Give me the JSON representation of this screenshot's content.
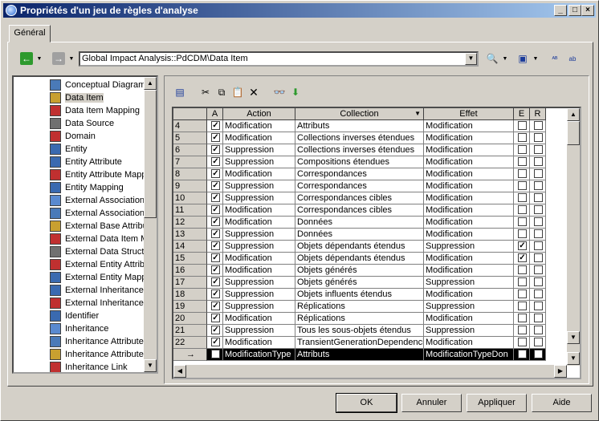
{
  "window": {
    "title": "Propriétés d'un jeu de règles d'analyse",
    "controls": [
      "_",
      "□",
      "×"
    ]
  },
  "tab": "Général",
  "path": "Global Impact Analysis::PdCDM\\Data Item",
  "tree": [
    "Conceptual Diagram",
    "Data Item",
    "Data Item Mapping",
    "Data Source",
    "Domain",
    "Entity",
    "Entity Attribute",
    "Entity Attribute Mappin",
    "Entity Mapping",
    "External Association A",
    "External Association M",
    "External Base Attribut",
    "External Data Item Ma",
    "External Data Structu",
    "External Entity Attribut",
    "External Entity Mappin",
    "External Inheritance A",
    "External Inheritance M",
    "Identifier",
    "Inheritance",
    "Inheritance Attribute",
    "Inheritance Attribute M",
    "Inheritance Link"
  ],
  "tree_selected": 1,
  "grid": {
    "headers": [
      "A",
      "Action",
      "Collection",
      "Effet",
      "E",
      "R"
    ],
    "rows": [
      [
        "4",
        "Modification",
        "Attributs",
        "Modification",
        false,
        false
      ],
      [
        "5",
        "Modification",
        "Collections inverses étendues",
        "Modification",
        false,
        false
      ],
      [
        "6",
        "Suppression",
        "Collections inverses étendues",
        "Modification",
        false,
        false
      ],
      [
        "7",
        "Suppression",
        "Compositions étendues",
        "Modification",
        false,
        false
      ],
      [
        "8",
        "Modification",
        "Correspondances",
        "Modification",
        false,
        false
      ],
      [
        "9",
        "Suppression",
        "Correspondances",
        "Modification",
        false,
        false
      ],
      [
        "10",
        "Suppression",
        "Correspondances cibles",
        "Modification",
        false,
        false
      ],
      [
        "11",
        "Modification",
        "Correspondances cibles",
        "Modification",
        false,
        false
      ],
      [
        "12",
        "Modification",
        "Données",
        "Modification",
        false,
        false
      ],
      [
        "13",
        "Suppression",
        "Données",
        "Modification",
        false,
        false
      ],
      [
        "14",
        "Suppression",
        "Objets dépendants étendus",
        "Suppression",
        true,
        false
      ],
      [
        "15",
        "Modification",
        "Objets dépendants étendus",
        "Modification",
        true,
        false
      ],
      [
        "16",
        "Modification",
        "Objets générés",
        "Modification",
        false,
        false
      ],
      [
        "17",
        "Suppression",
        "Objets générés",
        "Suppression",
        false,
        false
      ],
      [
        "18",
        "Suppression",
        "Objets influents étendus",
        "Modification",
        false,
        false
      ],
      [
        "19",
        "Suppression",
        "Réplications",
        "Suppression",
        false,
        false
      ],
      [
        "20",
        "Modification",
        "Réplications",
        "Modification",
        false,
        false
      ],
      [
        "21",
        "Suppression",
        "Tous les sous-objets étendus",
        "Suppression",
        false,
        false
      ],
      [
        "22",
        "Modification",
        "TransientGenerationDependenci",
        "Modification",
        false,
        false
      ],
      [
        "",
        "ModificationType",
        "Attributs",
        "ModificationTypeDon",
        true,
        false
      ]
    ]
  },
  "buttons": {
    "ok": "OK",
    "cancel": "Annuler",
    "apply": "Appliquer",
    "help": "Aide"
  }
}
